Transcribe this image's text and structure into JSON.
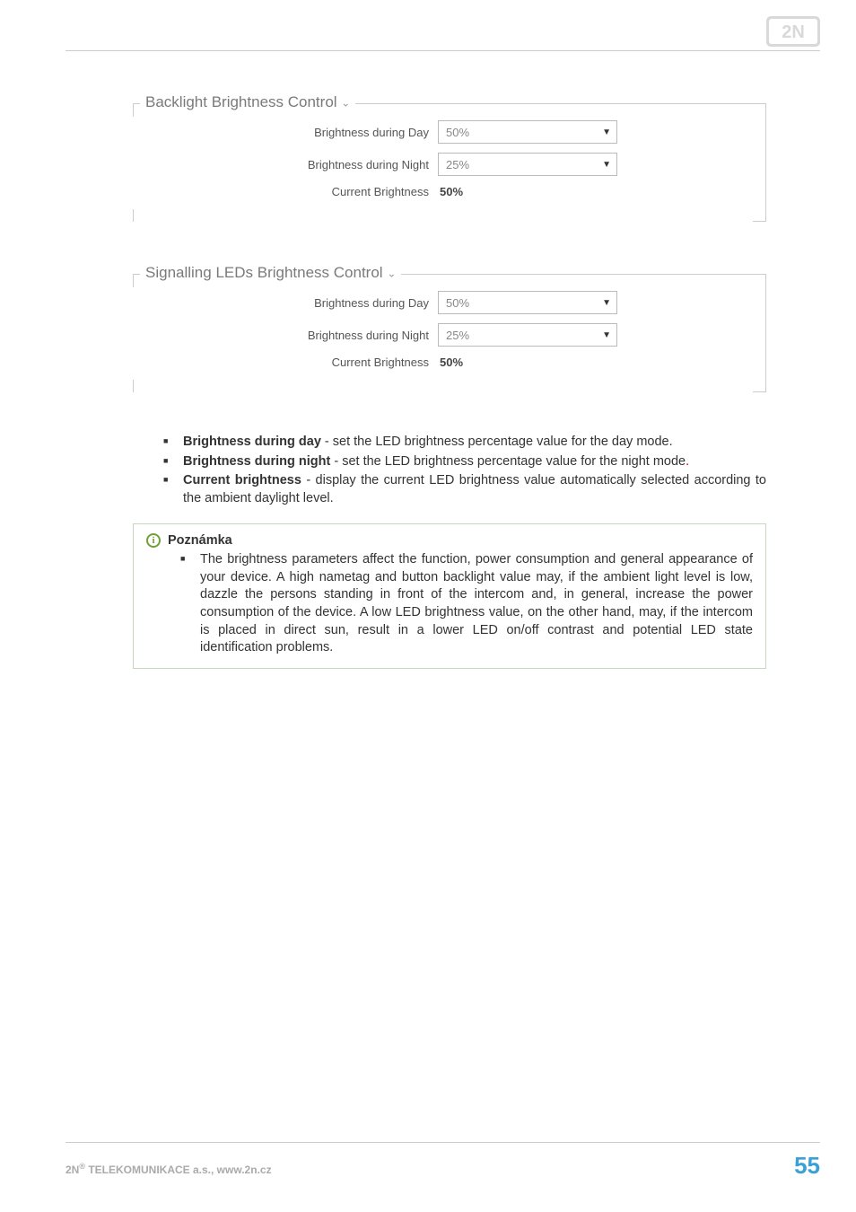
{
  "logo_text": "2N",
  "sections": {
    "backlight": {
      "title": "Backlight Brightness Control",
      "rows": {
        "day": {
          "label": "Brightness during Day",
          "value": "50%"
        },
        "night": {
          "label": "Brightness during Night",
          "value": "25%"
        },
        "current": {
          "label": "Current Brightness",
          "value": "50%"
        }
      }
    },
    "signalling": {
      "title": "Signalling LEDs Brightness Control",
      "rows": {
        "day": {
          "label": "Brightness during Day",
          "value": "50%"
        },
        "night": {
          "label": "Brightness during Night",
          "value": "25%"
        },
        "current": {
          "label": "Current Brightness",
          "value": "50%"
        }
      }
    }
  },
  "bullets": {
    "b1": {
      "term": "Brightness during day",
      "desc": " - set the LED brightness percentage value for the day mode."
    },
    "b2": {
      "term": "Brightness during night",
      "desc": " - set the LED brightness percentage value for the night mode",
      "dot": "."
    },
    "b3": {
      "term": "Current brightness",
      "desc": " - display the current LED brightness value automatically selected according to the ambient daylight level."
    }
  },
  "note": {
    "title": "Poznámka",
    "body": "The brightness parameters affect the function, power consumption and general appearance of your device. A high nametag and button backlight value may, if the ambient light level is low, dazzle the persons standing in front of the intercom and, in general, increase the power consumption of the device. A low LED brightness value, on the other hand, may, if the intercom is placed in direct sun, result in a lower LED on/off contrast and potential LED state identification problems."
  },
  "footer": {
    "company_prefix": "2N",
    "company_reg": "®",
    "company_rest": " TELEKOMUNIKACE a.s., www.2n.cz",
    "page": "55"
  }
}
